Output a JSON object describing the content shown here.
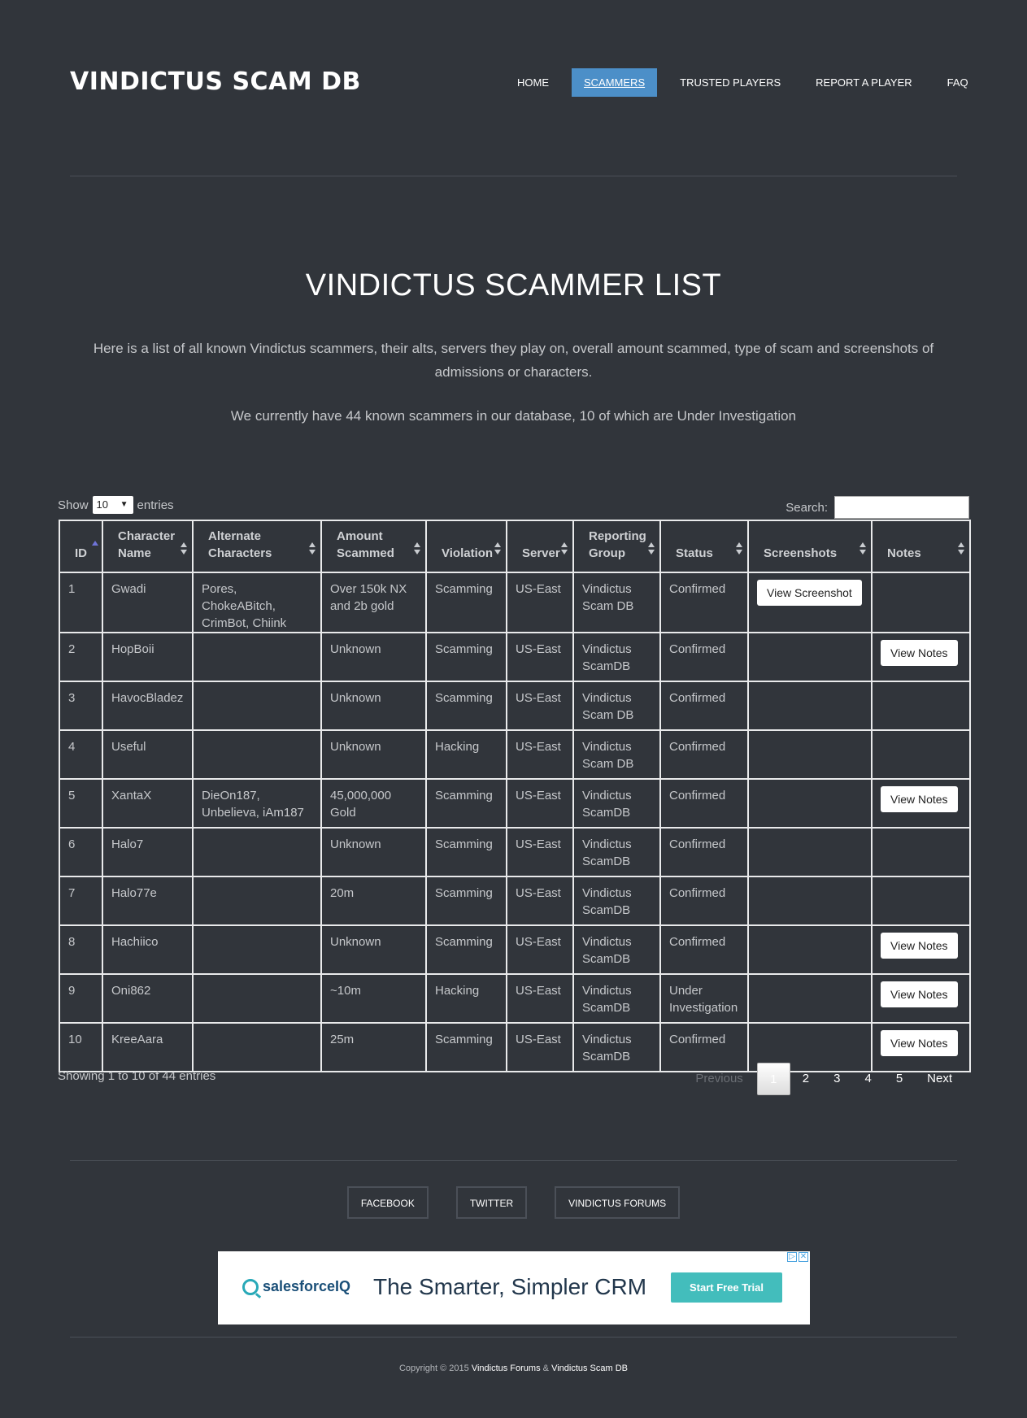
{
  "site": {
    "brand": "VINDICTUS SCAM DB"
  },
  "nav": {
    "items": [
      {
        "label": "HOME"
      },
      {
        "label": "SCAMMERS"
      },
      {
        "label": "TRUSTED PLAYERS"
      },
      {
        "label": "REPORT A PLAYER"
      },
      {
        "label": "FAQ"
      }
    ]
  },
  "page": {
    "title": "VINDICTUS SCAMMER LIST",
    "intro": "Here is a list of all known Vindictus scammers, their alts, servers they play on, overall amount scammed, type of scam and screenshots of admissions or characters.",
    "count_line": "We currently have 44 known scammers in our database, 10 of which are Under Investigation"
  },
  "table_controls": {
    "show_label": "Show",
    "entries_value": "10",
    "entries_label": "entries",
    "search_label": "Search:",
    "search_value": ""
  },
  "table": {
    "columns": [
      "ID",
      "Character Name",
      "Alternate Characters",
      "Amount Scammed",
      "Violation",
      "Server",
      "Reporting Group",
      "Status",
      "Screenshots",
      "Notes"
    ],
    "rows": [
      {
        "id": "1",
        "name": "Gwadi",
        "alts": "Pores, ChokeABitch, CrimBot, Chiink",
        "amount": "Over 150k NX and 2b gold",
        "violation": "Scamming",
        "server": "US-East",
        "group": "Vindictus Scam DB",
        "status": "Confirmed",
        "screenshot": "View Screenshot",
        "notes": ""
      },
      {
        "id": "2",
        "name": "HopBoii",
        "alts": "",
        "amount": "Unknown",
        "violation": "Scamming",
        "server": "US-East",
        "group": "Vindictus ScamDB",
        "status": "Confirmed",
        "screenshot": "",
        "notes": "View Notes"
      },
      {
        "id": "3",
        "name": "HavocBladez",
        "alts": "",
        "amount": "Unknown",
        "violation": "Scamming",
        "server": "US-East",
        "group": "Vindictus Scam DB",
        "status": "Confirmed",
        "screenshot": "",
        "notes": ""
      },
      {
        "id": "4",
        "name": "Useful",
        "alts": "",
        "amount": "Unknown",
        "violation": "Hacking",
        "server": "US-East",
        "group": "Vindictus Scam DB",
        "status": "Confirmed",
        "screenshot": "",
        "notes": ""
      },
      {
        "id": "5",
        "name": "XantaX",
        "alts": "DieOn187, Unbelieva, iAm187",
        "amount": "45,000,000 Gold",
        "violation": "Scamming",
        "server": "US-East",
        "group": "Vindictus ScamDB",
        "status": "Confirmed",
        "screenshot": "",
        "notes": "View Notes"
      },
      {
        "id": "6",
        "name": "Halo7",
        "alts": "",
        "amount": "Unknown",
        "violation": "Scamming",
        "server": "US-East",
        "group": "Vindictus ScamDB",
        "status": "Confirmed",
        "screenshot": "",
        "notes": ""
      },
      {
        "id": "7",
        "name": "Halo77e",
        "alts": "",
        "amount": "20m",
        "violation": "Scamming",
        "server": "US-East",
        "group": "Vindictus ScamDB",
        "status": "Confirmed",
        "screenshot": "",
        "notes": ""
      },
      {
        "id": "8",
        "name": "Hachiico",
        "alts": "",
        "amount": "Unknown",
        "violation": "Scamming",
        "server": "US-East",
        "group": "Vindictus ScamDB",
        "status": "Confirmed",
        "screenshot": "",
        "notes": "View Notes"
      },
      {
        "id": "9",
        "name": "Oni862",
        "alts": "",
        "amount": "~10m",
        "violation": "Hacking",
        "server": "US-East",
        "group": "Vindictus ScamDB",
        "status": "Under Investigation",
        "screenshot": "",
        "notes": "View Notes"
      },
      {
        "id": "10",
        "name": "KreeAara",
        "alts": "",
        "amount": "25m",
        "violation": "Scamming",
        "server": "US-East",
        "group": "Vindictus ScamDB",
        "status": "Confirmed",
        "screenshot": "",
        "notes": "View Notes"
      }
    ]
  },
  "pagination": {
    "info": "Showing 1 to 10 of 44 entries",
    "previous": "Previous",
    "pages": [
      "1",
      "2",
      "3",
      "4",
      "5"
    ],
    "next": "Next"
  },
  "footer": {
    "links": [
      "FACEBOOK",
      "TWITTER",
      "VINDICTUS FORUMS"
    ],
    "copyright_prefix": "Copyright © 2015",
    "copyright_link1": "Vindictus Forums",
    "copyright_amp": "&",
    "copyright_link2": "Vindictus Scam DB"
  },
  "ad": {
    "logo_text": "salesforceIQ",
    "headline": "The Smarter, Simpler CRM",
    "cta": "Start Free Trial",
    "choices_icon": "adchoices-icon",
    "close_icon": "close-icon"
  },
  "colors": {
    "background": "#31353b",
    "nav_active": "#4c8fc8",
    "ad_cta": "#43bdbc"
  }
}
